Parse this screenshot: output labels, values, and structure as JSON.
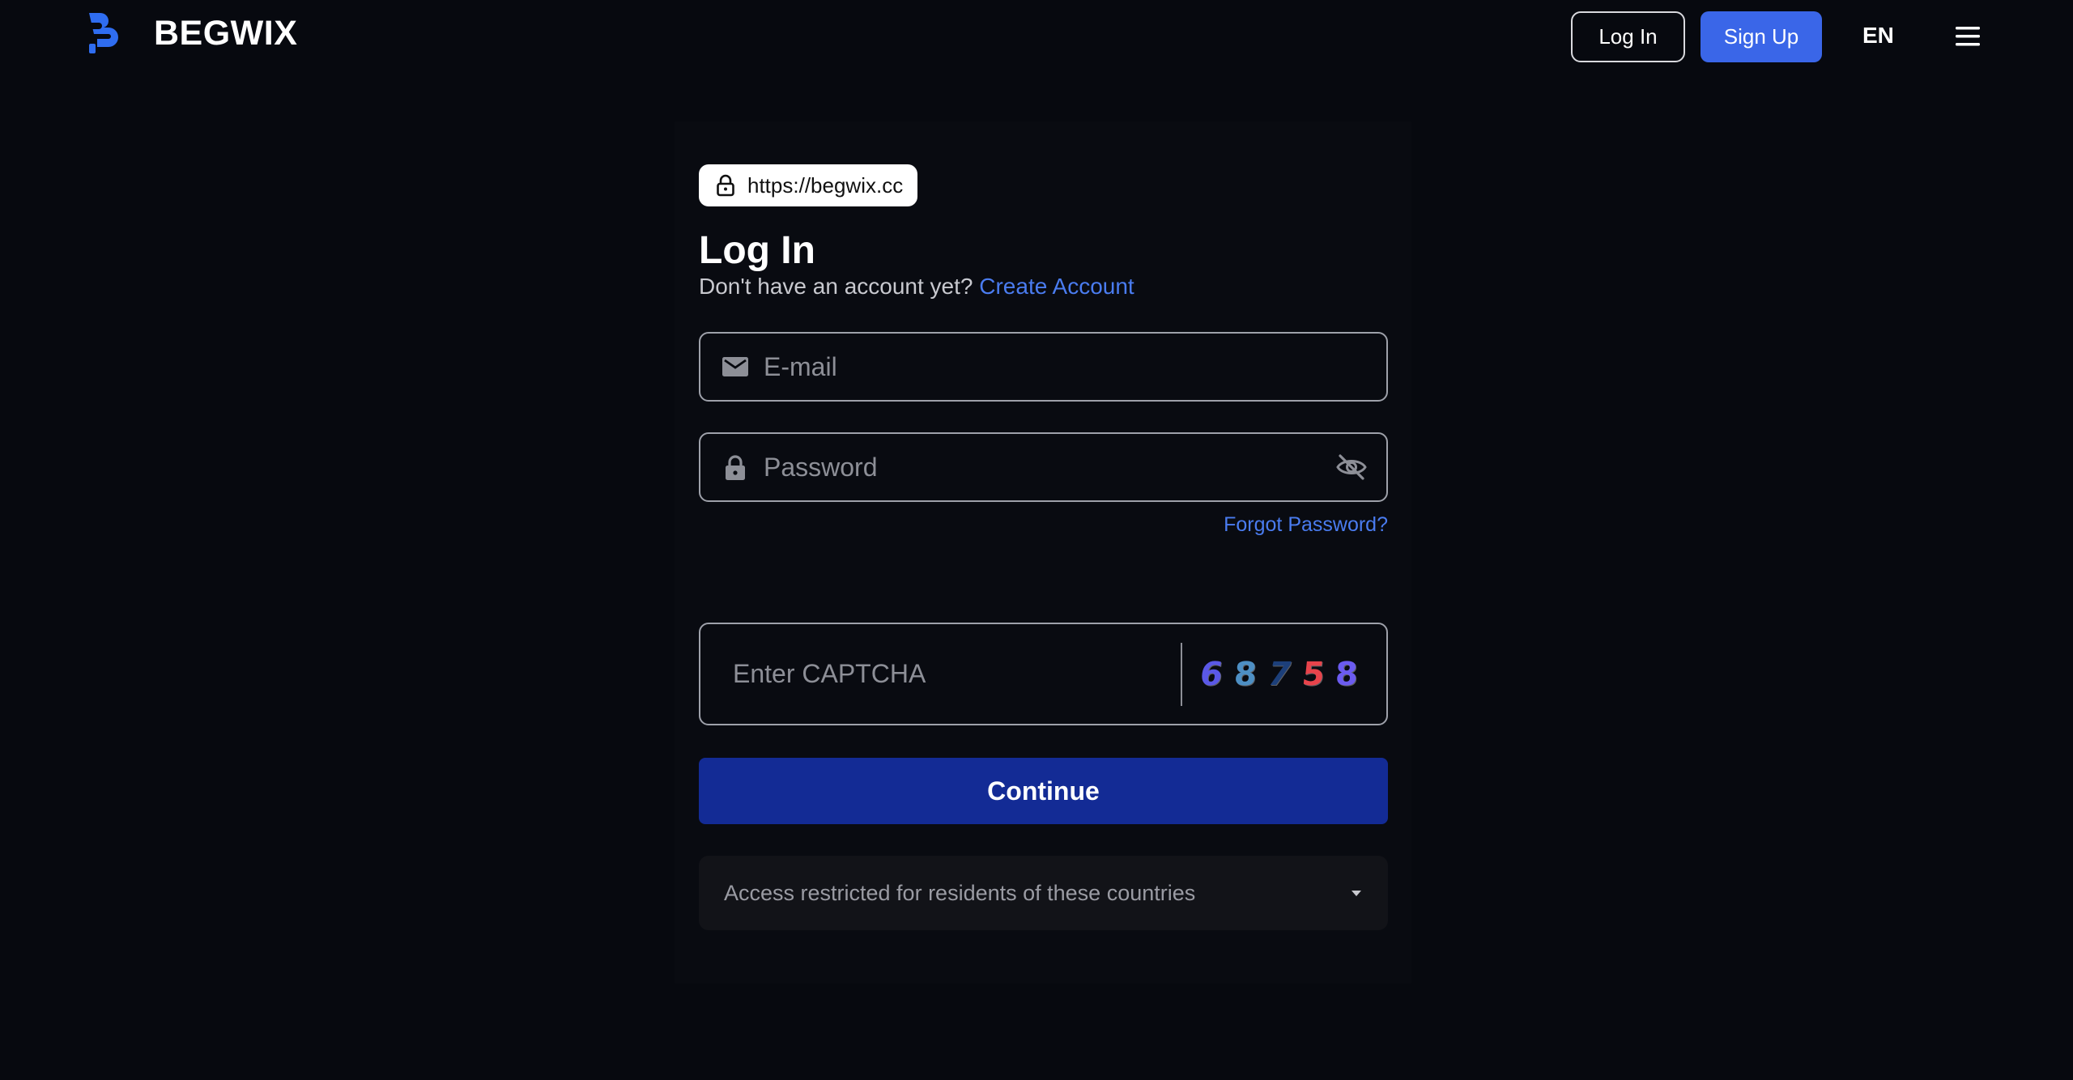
{
  "header": {
    "brand": "BEGWIX",
    "login_label": "Log In",
    "signup_label": "Sign Up",
    "language": "EN"
  },
  "url_badge": {
    "url": "https://begwix.cc"
  },
  "login": {
    "title": "Log In",
    "no_account_text": "Don't have an account yet?",
    "create_account_label": "Create Account",
    "email_placeholder": "E-mail",
    "password_placeholder": "Password",
    "forgot_password_label": "Forgot Password?",
    "captcha_placeholder": "Enter CAPTCHA",
    "captcha_digits": [
      "6",
      "8",
      "7",
      "5",
      "8"
    ],
    "continue_label": "Continue",
    "restricted_label": "Access restricted for residents of these countries"
  },
  "colors": {
    "background": "#07090f",
    "accent": "#3a66e8",
    "link": "#4a7cf0",
    "primary_button": "#132b95",
    "logo": "#2f6df0"
  },
  "icons": {
    "brand": "begwix-logo-icon",
    "menu": "hamburger-menu-icon",
    "url_lock": "lock-icon",
    "email": "mail-icon",
    "password": "lock-icon",
    "visibility": "eye-off-icon",
    "dropdown": "caret-down-icon"
  }
}
